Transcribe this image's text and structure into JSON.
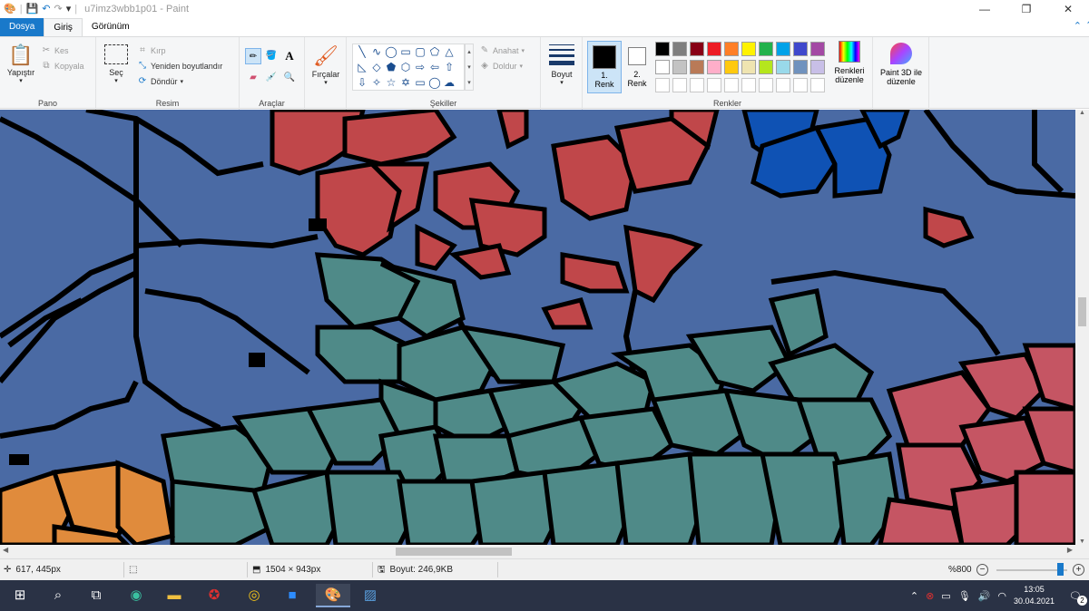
{
  "app": {
    "title": "u7imz3wbb1p01 - Paint"
  },
  "tabs": {
    "file": "Dosya",
    "home": "Giriş",
    "view": "Görünüm"
  },
  "ribbon": {
    "clipboard": {
      "label": "Pano",
      "paste": "Yapıştır",
      "cut": "Kes",
      "copy": "Kopyala"
    },
    "image": {
      "label": "Resim",
      "select": "Seç",
      "crop": "Kırp",
      "resize": "Yeniden boyutlandır",
      "rotate": "Döndür"
    },
    "tools": {
      "label": "Araçlar"
    },
    "brushes": {
      "label": "Fırçalar"
    },
    "shapes": {
      "label": "Şekiller",
      "outline": "Anahat",
      "fill": "Doldur"
    },
    "size": {
      "label": "Boyut"
    },
    "colors": {
      "label": "Renkler",
      "color1": [
        "1.",
        "Renk"
      ],
      "color2": [
        "2.",
        "Renk"
      ],
      "edit": [
        "Renkleri",
        "düzenle"
      ],
      "palette_row1": [
        "#000000",
        "#7f7f7f",
        "#880015",
        "#ed1c24",
        "#ff7f27",
        "#fff200",
        "#22b14c",
        "#00a2e8",
        "#3f48cc",
        "#a349a4"
      ],
      "palette_row2": [
        "#ffffff",
        "#c3c3c3",
        "#b97a57",
        "#ffaec9",
        "#ffc90e",
        "#efe4b0",
        "#b5e61d",
        "#99d9ea",
        "#7092be",
        "#c8bfe7"
      ]
    },
    "paint3d": [
      "Paint 3D ile",
      "düzenle"
    ]
  },
  "canvas": {
    "colors": {
      "sea": "#4a6aa4",
      "red": "#c0474a",
      "blue": "#0f52b4",
      "teal": "#4f8a88",
      "pink": "#c55563",
      "orange": "#e08b3c",
      "border": "#000000"
    }
  },
  "status": {
    "cursor": "617, 445px",
    "dimensions": "1504 × 943px",
    "filesize": "Boyut: 246,9KB",
    "zoom": "%800"
  },
  "taskbar": {
    "time": "13:05",
    "date": "30.04.2021",
    "notifications": "2"
  }
}
